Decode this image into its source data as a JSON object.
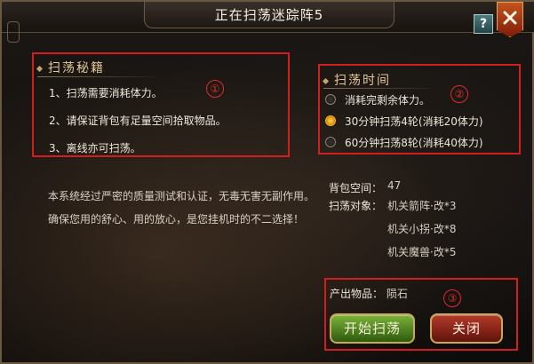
{
  "window": {
    "title": "正在扫荡迷踪阵5",
    "help_label": "?"
  },
  "rules": {
    "header": "扫荡秘籍",
    "marker": "①",
    "items": [
      "1、扫荡需要消耗体力。",
      "2、请保证背包有足量空间拾取物品。",
      "3、离线亦可扫荡。"
    ]
  },
  "description": "本系统经过严密的质量测试和认证，无毒无害无副作用。确保您用的舒心、用的放心，是您挂机时的不二选择！",
  "sweep_time": {
    "header": "扫荡时间",
    "marker": "②",
    "options": [
      {
        "label": "消耗完剩余体力。",
        "selected": false
      },
      {
        "label": "30分钟扫荡4轮(消耗20体力)",
        "selected": true
      },
      {
        "label": "60分钟扫荡8轮(消耗40体力)",
        "selected": false
      }
    ]
  },
  "info": {
    "bag_label": "背包空间：",
    "bag_value": "47",
    "target_label": "扫荡对象：",
    "targets": [
      "机关箭阵·改*3",
      "机关小拐·改*8",
      "机关魔兽·改*5"
    ]
  },
  "output": {
    "label": "产出物品：",
    "value": "陨石",
    "marker": "③"
  },
  "buttons": {
    "start": "开始扫荡",
    "close": "关闭"
  },
  "colors": {
    "annotation_red": "#d21e1e",
    "header_gold": "#e2c79a",
    "start_green": "#5a8f22",
    "close_red": "#8e2418"
  }
}
